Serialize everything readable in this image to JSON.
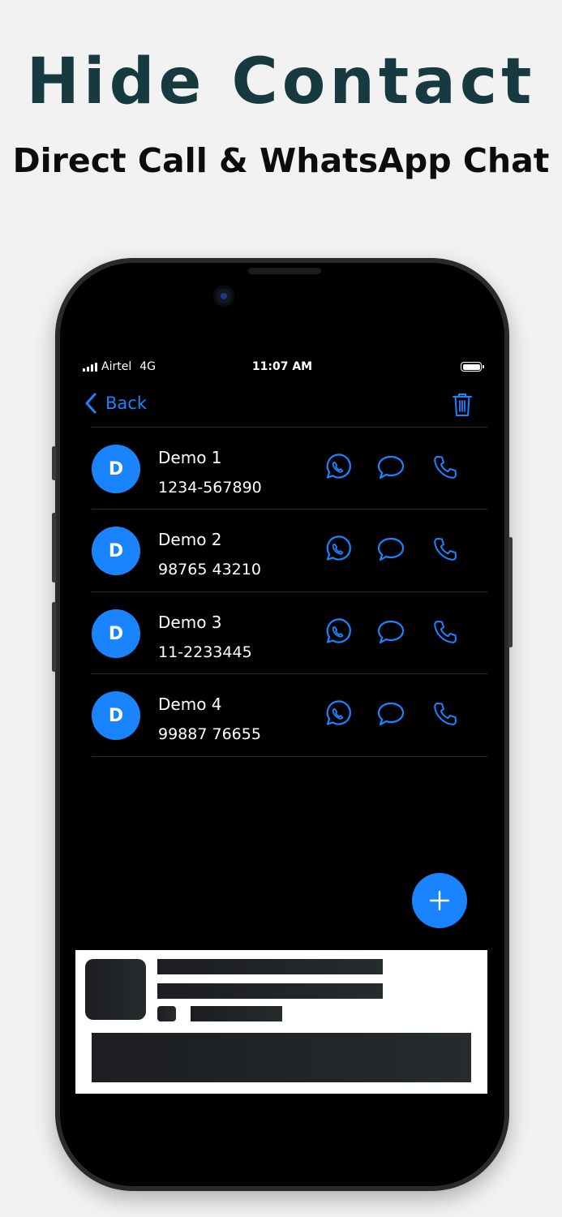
{
  "promo": {
    "title": "Hide Contact",
    "subtitle": "Direct Call & WhatsApp Chat"
  },
  "status_bar": {
    "carrier": "Airtel",
    "network": "4G",
    "time": "11:07 AM"
  },
  "nav": {
    "back_label": "Back",
    "trash_icon": "trash-icon"
  },
  "contacts": [
    {
      "initial": "D",
      "name": "Demo 1",
      "phone": "1234-567890"
    },
    {
      "initial": "D",
      "name": "Demo 2",
      "phone": "98765 43210"
    },
    {
      "initial": "D",
      "name": "Demo 3",
      "phone": "11-2233445"
    },
    {
      "initial": "D",
      "name": "Demo 4",
      "phone": "99887 76655"
    }
  ],
  "actions": [
    "whatsapp-icon",
    "message-icon",
    "phone-icon"
  ],
  "fab_icon": "plus-icon",
  "colors": {
    "accent": "#1a84ff",
    "headline": "#163a40",
    "background": "#f2f2f2",
    "screen": "#000000"
  }
}
